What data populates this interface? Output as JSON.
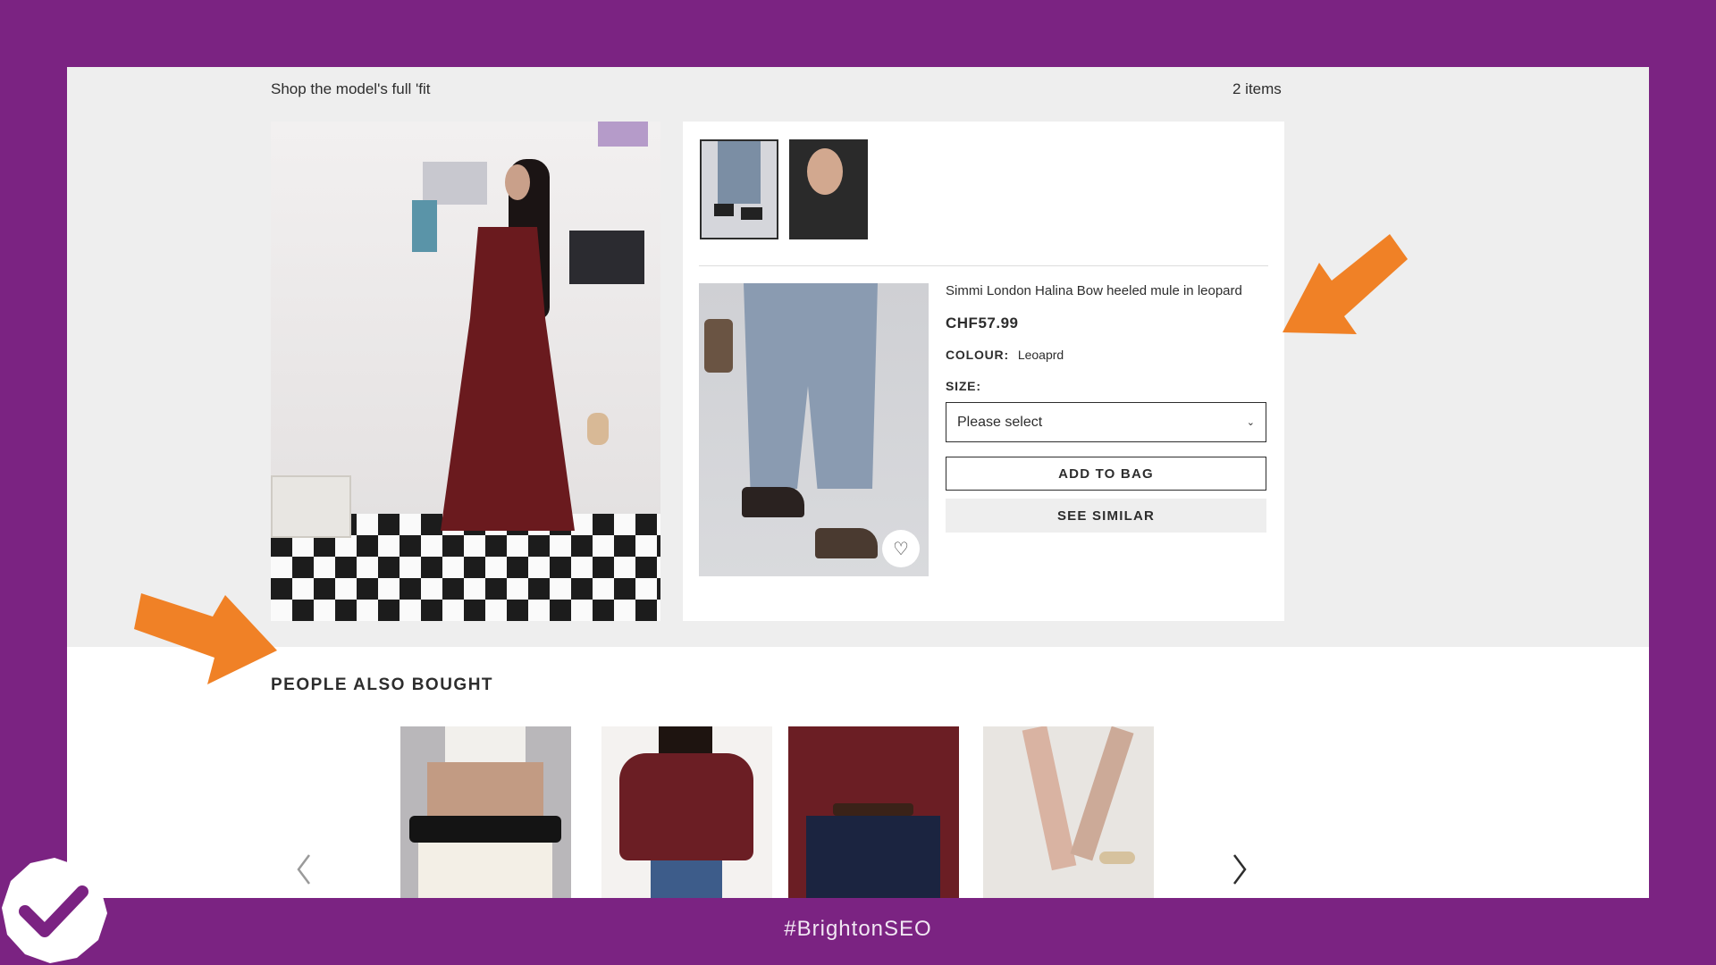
{
  "section": {
    "title": "Shop the model's full 'fit",
    "count": "2 items"
  },
  "product": {
    "name": "Simmi London Halina Bow heeled mule in leopard",
    "price": "CHF57.99",
    "colour_label": "COLOUR:",
    "colour_value": "Leoaprd",
    "size_label": "SIZE:",
    "size_placeholder": "Please select",
    "add_to_bag": "ADD TO BAG",
    "see_similar": "SEE SIMILAR"
  },
  "people_also_bought": {
    "title": "PEOPLE ALSO BOUGHT"
  },
  "footer": {
    "hashtag": "#BrightonSEO"
  },
  "colors": {
    "background": "#7b2382",
    "accent_arrow": "#f08126",
    "text": "#2d2d2d"
  },
  "icons": [
    "heart-icon",
    "chevron-down-icon",
    "chevron-left-icon",
    "chevron-right-icon",
    "checkmark-badge-icon",
    "arrow-annotation-icon"
  ]
}
